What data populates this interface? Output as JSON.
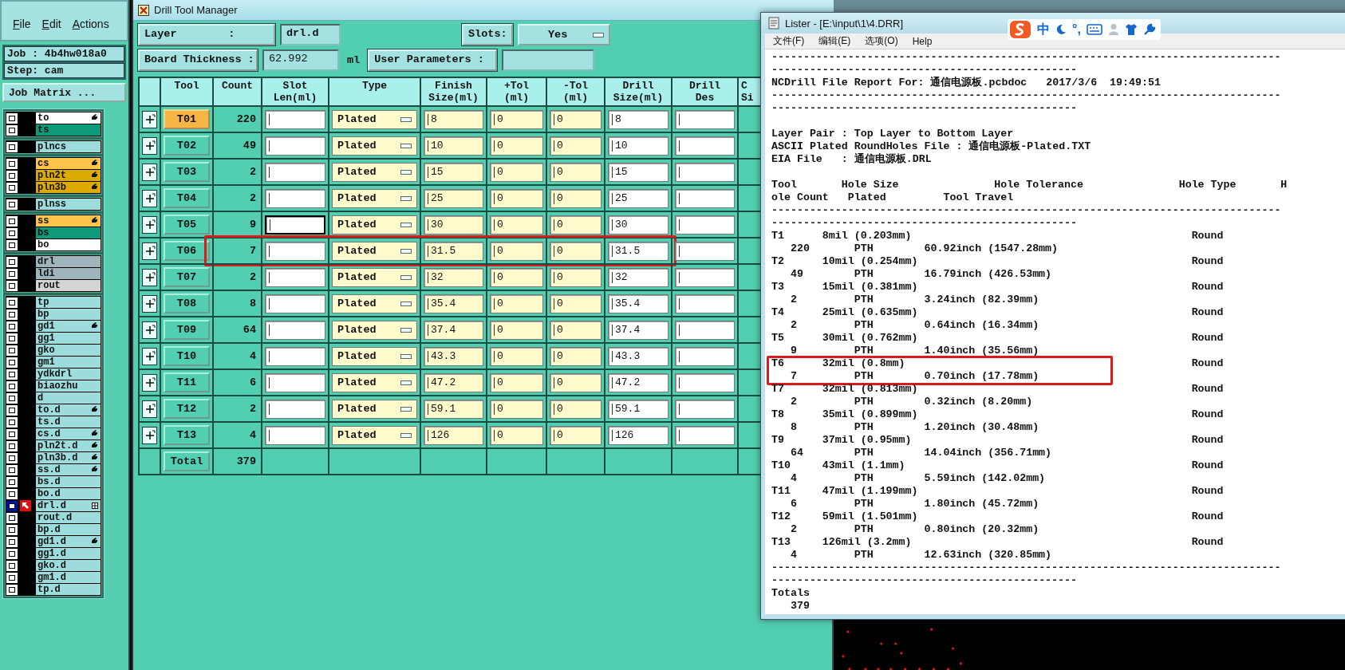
{
  "app_panel": {
    "menu": [
      "File",
      "Edit",
      "Actions"
    ],
    "job_label": "Job :",
    "job": "4b4hw018a0",
    "step_label": "Step:",
    "step": "cam",
    "matrix_button": "Job Matrix ...",
    "layer_groups": [
      {
        "layers": [
          {
            "name": "to",
            "color": "#ffffff",
            "marked": true,
            "selected": false
          },
          {
            "name": "ts",
            "color": "#0e9a78",
            "marked": false,
            "selected": false
          }
        ]
      },
      {
        "layers": [
          {
            "name": "plncs",
            "color": "#9cdcdc",
            "marked": false,
            "selected": false
          }
        ]
      },
      {
        "layers": [
          {
            "name": "cs",
            "color": "#ffc44c",
            "marked": true,
            "selected": false
          },
          {
            "name": "pln2t",
            "color": "#dcaa00",
            "marked": true,
            "selected": false
          },
          {
            "name": "pln3b",
            "color": "#dcaa00",
            "marked": true,
            "selected": false
          }
        ]
      },
      {
        "layers": [
          {
            "name": "plnss",
            "color": "#9cdcdc",
            "marked": false,
            "selected": false
          }
        ]
      },
      {
        "layers": [
          {
            "name": "ss",
            "color": "#ffc44c",
            "marked": true,
            "selected": false
          },
          {
            "name": "bs",
            "color": "#0e9a78",
            "marked": false,
            "selected": false
          },
          {
            "name": "bo",
            "color": "#ffffff",
            "marked": false,
            "selected": false
          }
        ]
      },
      {
        "layers": [
          {
            "name": "drl",
            "color": "#a0b4bc",
            "marked": false,
            "selected": false
          },
          {
            "name": "ldi",
            "color": "#a0b4bc",
            "marked": false,
            "selected": false
          },
          {
            "name": "rout",
            "color": "#d4d4d4",
            "marked": false,
            "selected": false
          }
        ]
      },
      {
        "layers": [
          {
            "name": "tp",
            "color": "#9cdcdc",
            "marked": false,
            "selected": false
          },
          {
            "name": "bp",
            "color": "#9cdcdc",
            "marked": false,
            "selected": false
          },
          {
            "name": "gd1",
            "color": "#9cdcdc",
            "marked": true,
            "selected": false
          },
          {
            "name": "gg1",
            "color": "#9cdcdc",
            "marked": false,
            "selected": false
          },
          {
            "name": "gko",
            "color": "#9cdcdc",
            "marked": false,
            "selected": false
          },
          {
            "name": "gm1",
            "color": "#9cdcdc",
            "marked": false,
            "selected": false
          },
          {
            "name": "ydkdrl",
            "color": "#9cdcdc",
            "marked": false,
            "selected": false
          },
          {
            "name": "biaozhu",
            "color": "#9cdcdc",
            "marked": false,
            "selected": false
          },
          {
            "name": "d",
            "color": "#9cdcdc",
            "marked": false,
            "selected": false
          },
          {
            "name": "to.d",
            "color": "#9cdcdc",
            "marked": true,
            "selected": false
          },
          {
            "name": "ts.d",
            "color": "#9cdcdc",
            "marked": false,
            "selected": false
          },
          {
            "name": "cs.d",
            "color": "#9cdcdc",
            "marked": true,
            "selected": false
          },
          {
            "name": "pln2t.d",
            "color": "#9cdcdc",
            "marked": true,
            "selected": false
          },
          {
            "name": "pln3b.d",
            "color": "#9cdcdc",
            "marked": true,
            "selected": false
          },
          {
            "name": "ss.d",
            "color": "#9cdcdc",
            "marked": true,
            "selected": false
          },
          {
            "name": "bs.d",
            "color": "#9cdcdc",
            "marked": false,
            "selected": false
          },
          {
            "name": "bo.d",
            "color": "#9cdcdc",
            "marked": false,
            "selected": false
          },
          {
            "name": "drl.d",
            "color": "#9cdcdc",
            "marked": false,
            "selected": true
          },
          {
            "name": "rout.d",
            "color": "#9cdcdc",
            "marked": false,
            "selected": false
          },
          {
            "name": "bp.d",
            "color": "#9cdcdc",
            "marked": false,
            "selected": false
          },
          {
            "name": "gd1.d",
            "color": "#9cdcdc",
            "marked": true,
            "selected": false
          },
          {
            "name": "gg1.d",
            "color": "#9cdcdc",
            "marked": false,
            "selected": false
          },
          {
            "name": "gko.d",
            "color": "#9cdcdc",
            "marked": false,
            "selected": false
          },
          {
            "name": "gm1.d",
            "color": "#9cdcdc",
            "marked": false,
            "selected": false
          },
          {
            "name": "tp.d",
            "color": "#9cdcdc",
            "marked": false,
            "selected": false
          }
        ]
      }
    ]
  },
  "drill_tool_manager": {
    "title": "Drill Tool Manager",
    "layer_label": "Layer        :",
    "layer": "drl.d",
    "slots_label": "Slots:",
    "slots": "Yes",
    "thickness_label": "Board Thickness :",
    "thickness": "62.992",
    "thickness_unit": "ml",
    "user_params_label": "User Parameters :",
    "columns": [
      "Tool",
      "Count",
      "Slot\nLen(ml)",
      "Type",
      "Finish\nSize(ml)",
      "+Tol\n(ml)",
      "-Tol\n(ml)",
      "Drill\nSize(ml)",
      "Drill\nDes",
      "C\nSi"
    ],
    "rows": [
      {
        "tool": "T01",
        "selected": true,
        "count": "220",
        "slot_focused": false,
        "type": "Plated",
        "finish": "8",
        "plus_tol": "0",
        "minus_tol": "0",
        "drill_size": "8",
        "highlighted": false
      },
      {
        "tool": "T02",
        "selected": false,
        "count": "49",
        "slot_focused": false,
        "type": "Plated",
        "finish": "10",
        "plus_tol": "0",
        "minus_tol": "0",
        "drill_size": "10",
        "highlighted": false
      },
      {
        "tool": "T03",
        "selected": false,
        "count": "2",
        "slot_focused": false,
        "type": "Plated",
        "finish": "15",
        "plus_tol": "0",
        "minus_tol": "0",
        "drill_size": "15",
        "highlighted": false
      },
      {
        "tool": "T04",
        "selected": false,
        "count": "2",
        "slot_focused": false,
        "type": "Plated",
        "finish": "25",
        "plus_tol": "0",
        "minus_tol": "0",
        "drill_size": "25",
        "highlighted": false
      },
      {
        "tool": "T05",
        "selected": false,
        "count": "9",
        "slot_focused": true,
        "type": "Plated",
        "finish": "30",
        "plus_tol": "0",
        "minus_tol": "0",
        "drill_size": "30",
        "highlighted": false
      },
      {
        "tool": "T06",
        "selected": false,
        "count": "7",
        "slot_focused": false,
        "type": "Plated",
        "finish": "31.5",
        "plus_tol": "0",
        "minus_tol": "0",
        "drill_size": "31.5",
        "highlighted": true
      },
      {
        "tool": "T07",
        "selected": false,
        "count": "2",
        "slot_focused": false,
        "type": "Plated",
        "finish": "32",
        "plus_tol": "0",
        "minus_tol": "0",
        "drill_size": "32",
        "highlighted": false
      },
      {
        "tool": "T08",
        "selected": false,
        "count": "8",
        "slot_focused": false,
        "type": "Plated",
        "finish": "35.4",
        "plus_tol": "0",
        "minus_tol": "0",
        "drill_size": "35.4",
        "highlighted": false
      },
      {
        "tool": "T09",
        "selected": false,
        "count": "64",
        "slot_focused": false,
        "type": "Plated",
        "finish": "37.4",
        "plus_tol": "0",
        "minus_tol": "0",
        "drill_size": "37.4",
        "highlighted": false
      },
      {
        "tool": "T10",
        "selected": false,
        "count": "4",
        "slot_focused": false,
        "type": "Plated",
        "finish": "43.3",
        "plus_tol": "0",
        "minus_tol": "0",
        "drill_size": "43.3",
        "highlighted": false
      },
      {
        "tool": "T11",
        "selected": false,
        "count": "6",
        "slot_focused": false,
        "type": "Plated",
        "finish": "47.2",
        "plus_tol": "0",
        "minus_tol": "0",
        "drill_size": "47.2",
        "highlighted": false
      },
      {
        "tool": "T12",
        "selected": false,
        "count": "2",
        "slot_focused": false,
        "type": "Plated",
        "finish": "59.1",
        "plus_tol": "0",
        "minus_tol": "0",
        "drill_size": "59.1",
        "highlighted": false
      },
      {
        "tool": "T13",
        "selected": false,
        "count": "4",
        "slot_focused": false,
        "type": "Plated",
        "finish": "126",
        "plus_tol": "0",
        "minus_tol": "0",
        "drill_size": "126",
        "highlighted": false
      }
    ],
    "total": {
      "label": "Total",
      "count": "379"
    }
  },
  "lister": {
    "title": "Lister - [E:\\input\\1\\4.DRR]",
    "menu": [
      "文件(F)",
      "编辑(E)",
      "选项(O)",
      "Help"
    ],
    "ime": {
      "mode": "中",
      "punct": "°,"
    },
    "lines_top": [
      {
        "kind": "text",
        "text": "--------------------------------------------------------------------------------"
      },
      {
        "kind": "text",
        "text": "------------------------------------------------"
      },
      {
        "kind": "text",
        "text": "NCDrill File Report For: 通信电源板.pcbdoc   2017/3/6  19:49:51"
      },
      {
        "kind": "text",
        "text": "--------------------------------------------------------------------------------"
      },
      {
        "kind": "text",
        "text": "------------------------------------------------"
      },
      {
        "kind": "blank"
      },
      {
        "kind": "text",
        "text": "Layer Pair : Top Layer to Bottom Layer"
      },
      {
        "kind": "text",
        "text": "ASCII Plated RoundHoles File : 通信电源板-Plated.TXT"
      },
      {
        "kind": "text",
        "text": "EIA File   : 通信电源板.DRL"
      },
      {
        "kind": "blank"
      },
      {
        "kind": "text",
        "text": "Tool       Hole Size               Hole Tolerance               Hole Type       H"
      },
      {
        "kind": "text",
        "text": "ole Count   Plated         Tool Travel"
      },
      {
        "kind": "text",
        "text": "--------------------------------------------------------------------------------"
      },
      {
        "kind": "text",
        "text": "------------------------------------------------"
      }
    ],
    "entries": [
      {
        "tool": "T1",
        "hole_size": "8mil (0.203mm)",
        "hole_type": "Round",
        "count": "220",
        "plated": "PTH",
        "travel": "60.92inch (1547.28mm)",
        "highlighted": false
      },
      {
        "tool": "T2",
        "hole_size": "10mil (0.254mm)",
        "hole_type": "Round",
        "count": "49",
        "plated": "PTH",
        "travel": "16.79inch (426.53mm)",
        "highlighted": false
      },
      {
        "tool": "T3",
        "hole_size": "15mil (0.381mm)",
        "hole_type": "Round",
        "count": "2",
        "plated": "PTH",
        "travel": "3.24inch (82.39mm)",
        "highlighted": false
      },
      {
        "tool": "T4",
        "hole_size": "25mil (0.635mm)",
        "hole_type": "Round",
        "count": "2",
        "plated": "PTH",
        "travel": "0.64inch (16.34mm)",
        "highlighted": false
      },
      {
        "tool": "T5",
        "hole_size": "30mil (0.762mm)",
        "hole_type": "Round",
        "count": "9",
        "plated": "PTH",
        "travel": "1.40inch (35.56mm)",
        "highlighted": false
      },
      {
        "tool": "T6",
        "hole_size": "32mil (0.8mm)",
        "hole_type": "Round",
        "count": "7",
        "plated": "PTH",
        "travel": "0.70inch (17.78mm)",
        "highlighted": true
      },
      {
        "tool": "T7",
        "hole_size": "32mil (0.813mm)",
        "hole_type": "Round",
        "count": "2",
        "plated": "PTH",
        "travel": "0.32inch (8.20mm)",
        "highlighted": false
      },
      {
        "tool": "T8",
        "hole_size": "35mil (0.899mm)",
        "hole_type": "Round",
        "count": "8",
        "plated": "PTH",
        "travel": "1.20inch (30.48mm)",
        "highlighted": false
      },
      {
        "tool": "T9",
        "hole_size": "37mil (0.95mm)",
        "hole_type": "Round",
        "count": "64",
        "plated": "PTH",
        "travel": "14.04inch (356.71mm)",
        "highlighted": false
      },
      {
        "tool": "T10",
        "hole_size": "43mil (1.1mm)",
        "hole_type": "Round",
        "count": "4",
        "plated": "PTH",
        "travel": "5.59inch (142.02mm)",
        "highlighted": false
      },
      {
        "tool": "T11",
        "hole_size": "47mil (1.199mm)",
        "hole_type": "Round",
        "count": "6",
        "plated": "PTH",
        "travel": "1.80inch (45.72mm)",
        "highlighted": false
      },
      {
        "tool": "T12",
        "hole_size": "59mil (1.501mm)",
        "hole_type": "Round",
        "count": "2",
        "plated": "PTH",
        "travel": "0.80inch (20.32mm)",
        "highlighted": false
      },
      {
        "tool": "T13",
        "hole_size": "126mil (3.2mm)",
        "hole_type": "Round",
        "count": "4",
        "plated": "PTH",
        "travel": "12.63inch (320.85mm)",
        "highlighted": false
      }
    ],
    "lines_bottom": [
      {
        "kind": "text",
        "text": "--------------------------------------------------------------------------------"
      },
      {
        "kind": "text",
        "text": "------------------------------------------------"
      },
      {
        "kind": "text",
        "text": "Totals"
      },
      {
        "kind": "text",
        "text": "   379"
      }
    ]
  }
}
